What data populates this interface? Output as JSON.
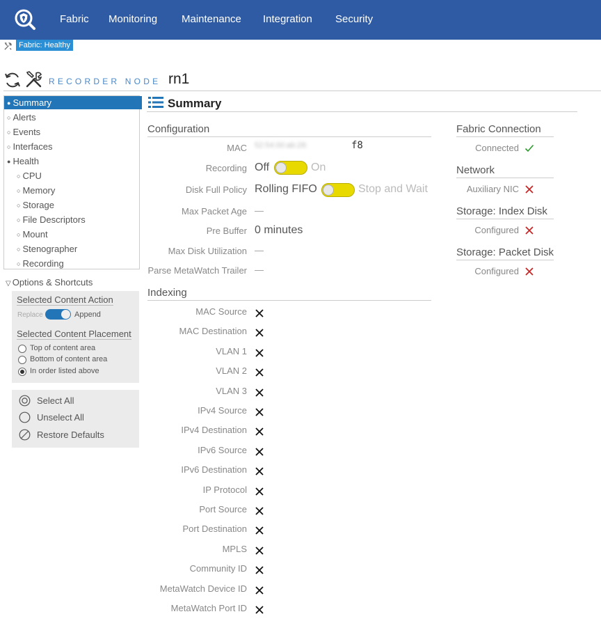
{
  "colors": {
    "nav_bg": "#2f5ba5",
    "accent": "#2276b8",
    "toggle": "#e8da00",
    "error": "#c62828",
    "ok": "#2e9b2e"
  },
  "nav": {
    "items": [
      "Fabric",
      "Monitoring",
      "Maintenance",
      "Integration",
      "Security"
    ]
  },
  "status": {
    "badge": "Fabric: Healthy"
  },
  "title": {
    "label": "RECORDER NODE",
    "value": "rn1"
  },
  "sidebar": {
    "items": [
      {
        "label": "Summary",
        "level": 0,
        "active": true
      },
      {
        "label": "Alerts",
        "level": 0
      },
      {
        "label": "Events",
        "level": 0
      },
      {
        "label": "Interfaces",
        "level": 0
      },
      {
        "label": "Health",
        "level": 0,
        "expanded": true
      },
      {
        "label": "CPU",
        "level": 1
      },
      {
        "label": "Memory",
        "level": 1
      },
      {
        "label": "Storage",
        "level": 1
      },
      {
        "label": "File Descriptors",
        "level": 1
      },
      {
        "label": "Mount",
        "level": 1
      },
      {
        "label": "Stenographer",
        "level": 1
      },
      {
        "label": "Recording",
        "level": 1
      }
    ]
  },
  "options": {
    "header": "Options & Shortcuts",
    "content_action": {
      "title": "Selected Content Action",
      "off": "Replace",
      "on": "Append"
    },
    "content_placement": {
      "title": "Selected Content Placement",
      "options": [
        "Top of content area",
        "Bottom of content area",
        "In order listed above"
      ],
      "selected": 2
    },
    "actions": [
      "Select All",
      "Unselect All",
      "Restore Defaults"
    ]
  },
  "summary": {
    "header": "Summary",
    "configuration": {
      "title": "Configuration",
      "mac_label": "MAC",
      "mac_visible": "f8",
      "mac_obscured": "52:54:00:ab:28:",
      "recording_label": "Recording",
      "recording_off": "Off",
      "recording_on": "On",
      "disk_full_label": "Disk Full Policy",
      "disk_full_off": "Rolling FIFO",
      "disk_full_on": "Stop and Wait",
      "max_age_label": "Max Packet Age",
      "max_age_value": "—",
      "pre_buffer_label": "Pre Buffer",
      "pre_buffer_value": "0 minutes",
      "max_disk_label": "Max Disk Utilization",
      "max_disk_value": "—",
      "parse_label": "Parse MetaWatch Trailer",
      "parse_value": "—"
    },
    "indexing": {
      "title": "Indexing",
      "fields": [
        "MAC Source",
        "MAC Destination",
        "VLAN 1",
        "VLAN 2",
        "VLAN 3",
        "IPv4 Source",
        "IPv4 Destination",
        "IPv6 Source",
        "IPv6 Destination",
        "IP Protocol",
        "Port Source",
        "Port Destination",
        "MPLS",
        "Community ID",
        "MetaWatch Device ID",
        "MetaWatch Port ID"
      ]
    },
    "right": [
      {
        "title": "Fabric Connection",
        "value": "Connected",
        "status": "ok"
      },
      {
        "title": "Network",
        "value": "Auxiliary NIC",
        "status": "error"
      },
      {
        "title": "Storage: Index Disk",
        "value": "Configured",
        "status": "error"
      },
      {
        "title": "Storage: Packet Disk",
        "value": "Configured",
        "status": "error"
      }
    ]
  }
}
